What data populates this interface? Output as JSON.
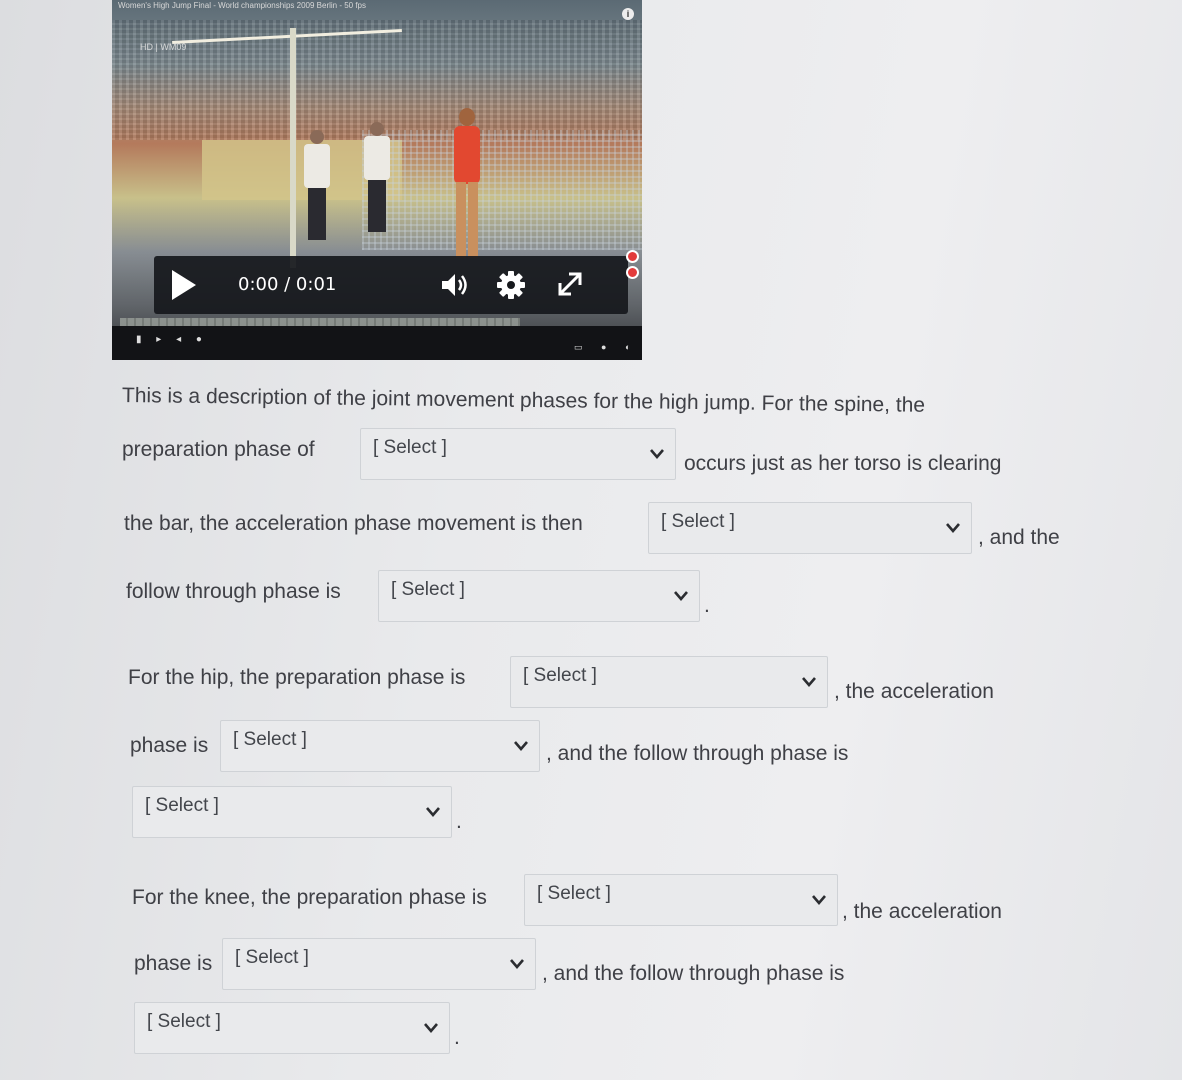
{
  "video": {
    "title": "Women's High Jump Final - World championships 2009 Berlin - 50 fps",
    "badge": "HD | WM09",
    "time": "0:00 / 0:01",
    "info_icon": "info-icon",
    "icons": [
      "play-icon",
      "volume-icon",
      "gear-icon",
      "fullscreen-icon"
    ]
  },
  "question": {
    "line1": "This is a description of the joint movement phases for the high jump.  For the spine, the",
    "line2a": "preparation phase of",
    "line2b": "occurs just as her torso is clearing",
    "line3a": "the bar, the acceleration phase movement is then",
    "line3b": ", and the",
    "line4a": "follow through phase is",
    "line5a": "For the hip, the preparation phase is",
    "line5b": ", the acceleration",
    "line6a": "phase is",
    "line6b": ", and the follow through phase is",
    "line8a": "For the knee, the preparation phase is",
    "line8b": ", the acceleration",
    "line9a": "phase is",
    "line9b": ", and the follow through phase is",
    "period": "."
  },
  "selects": {
    "spine_prep": "[ Select ]",
    "spine_accel": "[ Select ]",
    "spine_follow": "[ Select ]",
    "hip_prep": "[ Select ]",
    "hip_accel": "[ Select ]",
    "hip_follow": "[ Select ]",
    "knee_prep": "[ Select ]",
    "knee_accel": "[ Select ]",
    "knee_follow": "[ Select ]"
  }
}
